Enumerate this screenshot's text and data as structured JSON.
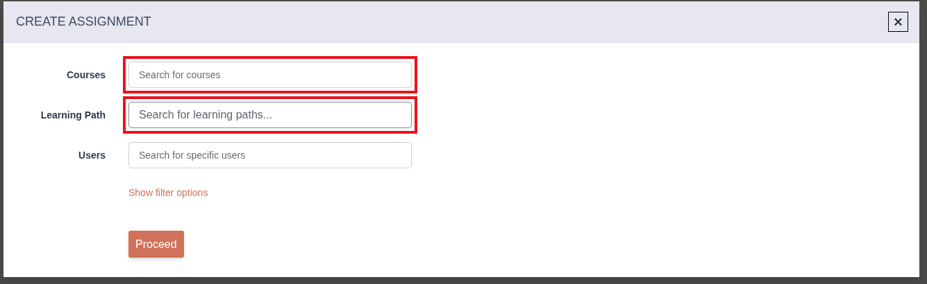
{
  "dialog": {
    "title": "CREATE ASSIGNMENT",
    "close_label": "×"
  },
  "fields": [
    {
      "label": "Courses",
      "placeholder": "Search for courses",
      "highlighted": true,
      "focused": false
    },
    {
      "label": "Learning Path",
      "placeholder": "Search for learning paths...",
      "highlighted": true,
      "focused": true
    },
    {
      "label": "Users",
      "placeholder": "Search for specific users",
      "highlighted": false,
      "focused": false
    }
  ],
  "filter_link": "Show filter options",
  "proceed_button": "Proceed"
}
